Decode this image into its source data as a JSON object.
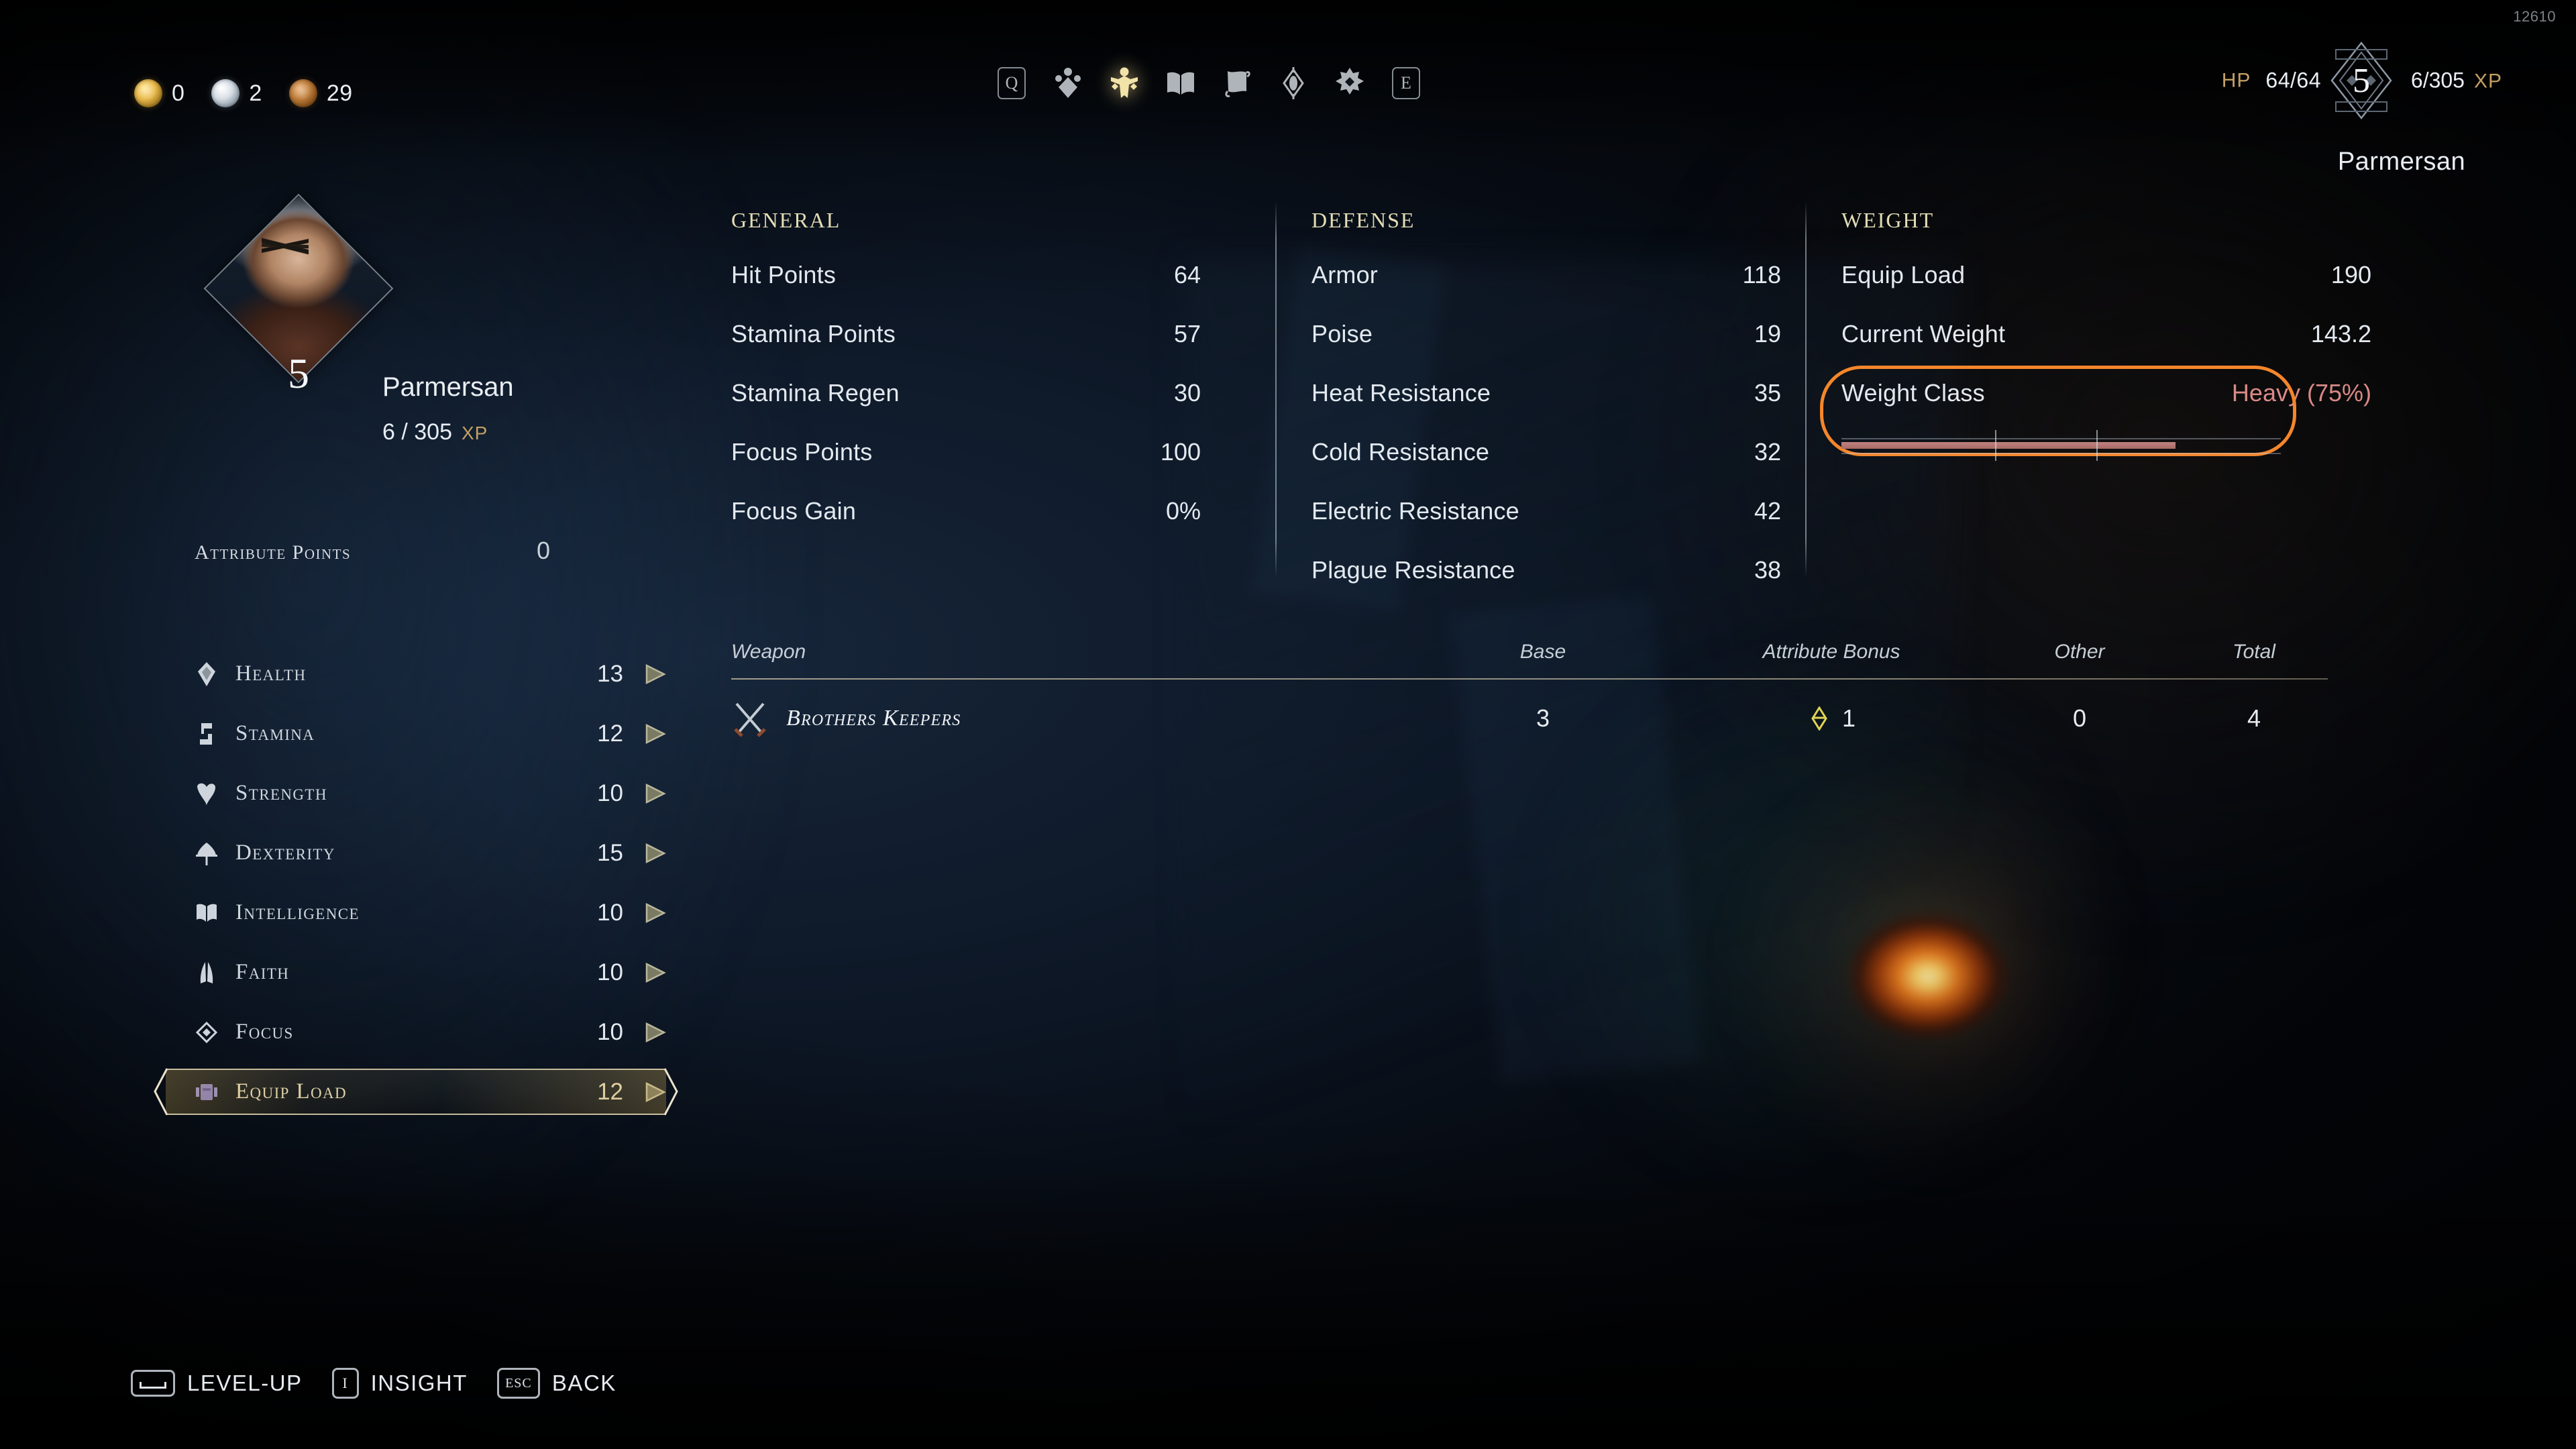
{
  "debug_counter": "12610",
  "currency": [
    {
      "type": "gold-coin",
      "value": "0"
    },
    {
      "type": "silver-coin",
      "value": "2"
    },
    {
      "type": "bronze-coin",
      "value": "29"
    }
  ],
  "topnav": [
    {
      "icon": "key-q",
      "label": "Q",
      "active": false
    },
    {
      "icon": "inventory-gem",
      "label": "Inventory",
      "active": false
    },
    {
      "icon": "character-figure",
      "label": "Character",
      "active": true
    },
    {
      "icon": "book",
      "label": "Journal",
      "active": false
    },
    {
      "icon": "map-scroll",
      "label": "Map",
      "active": false
    },
    {
      "icon": "eye",
      "label": "Insight",
      "active": false
    },
    {
      "icon": "gear",
      "label": "Settings",
      "active": false
    },
    {
      "icon": "key-e",
      "label": "E",
      "active": false
    }
  ],
  "header": {
    "hp_label": "HP",
    "hp_value": "64/64",
    "level": "5",
    "xp_value": "6/305",
    "xp_unit": "XP",
    "character_name": "Parmersan"
  },
  "character": {
    "name": "Parmersan",
    "level": "5",
    "xp_value": "6 / 305",
    "xp_unit": "XP",
    "attribute_points_label": "Attribute Points",
    "attribute_points_value": "0"
  },
  "attributes": [
    {
      "icon": "health-icon",
      "label": "Health",
      "value": "13",
      "selected": false
    },
    {
      "icon": "stamina-icon",
      "label": "Stamina",
      "value": "12",
      "selected": false
    },
    {
      "icon": "strength-icon",
      "label": "Strength",
      "value": "10",
      "selected": false
    },
    {
      "icon": "dexterity-icon",
      "label": "Dexterity",
      "value": "15",
      "selected": false
    },
    {
      "icon": "intelligence-icon",
      "label": "Intelligence",
      "value": "10",
      "selected": false
    },
    {
      "icon": "faith-icon",
      "label": "Faith",
      "value": "10",
      "selected": false
    },
    {
      "icon": "focus-icon",
      "label": "Focus",
      "value": "10",
      "selected": false
    },
    {
      "icon": "equip-load-icon",
      "label": "Equip Load",
      "value": "12",
      "selected": true
    }
  ],
  "stats": {
    "general": {
      "title": "General",
      "rows": [
        {
          "label": "Hit Points",
          "value": "64"
        },
        {
          "label": "Stamina Points",
          "value": "57"
        },
        {
          "label": "Stamina Regen",
          "value": "30"
        },
        {
          "label": "Focus Points",
          "value": "100"
        },
        {
          "label": "Focus Gain",
          "value": "0%"
        }
      ]
    },
    "defense": {
      "title": "Defense",
      "rows": [
        {
          "label": "Armor",
          "value": "118"
        },
        {
          "label": "Poise",
          "value": "19"
        },
        {
          "label": "Heat Resistance",
          "value": "35"
        },
        {
          "label": "Cold Resistance",
          "value": "32"
        },
        {
          "label": "Electric Resistance",
          "value": "42"
        },
        {
          "label": "Plague Resistance",
          "value": "38"
        }
      ]
    },
    "weight": {
      "title": "Weight",
      "rows": [
        {
          "label": "Equip Load",
          "value": "190"
        },
        {
          "label": "Current Weight",
          "value": "143.2"
        }
      ],
      "weight_class": {
        "label": "Weight Class",
        "value": "Heavy  (75%)",
        "class_name": "Heavy",
        "percent": 75,
        "fill_percent": 76,
        "ticks": [
          35,
          58
        ],
        "highlight_color": "#f5862b",
        "value_color": "#d98a86"
      }
    }
  },
  "weapon_table": {
    "headers": {
      "weapon": "Weapon",
      "base": "Base",
      "attribute_bonus": "Attribute Bonus",
      "other": "Other",
      "total": "Total"
    },
    "rows": [
      {
        "icon": "crossed-swords-icon",
        "name": "Brothers Keepers",
        "base": "3",
        "bonus_icon": "dexterity-bonus-icon",
        "bonus": "1",
        "other": "0",
        "total": "4"
      }
    ]
  },
  "footer": [
    {
      "key": "space",
      "key_label": "",
      "action": "LEVEL-UP"
    },
    {
      "key": "I",
      "key_label": "I",
      "action": "INSIGHT"
    },
    {
      "key": "ESC",
      "key_label": "ESC",
      "action": "BACK"
    }
  ]
}
